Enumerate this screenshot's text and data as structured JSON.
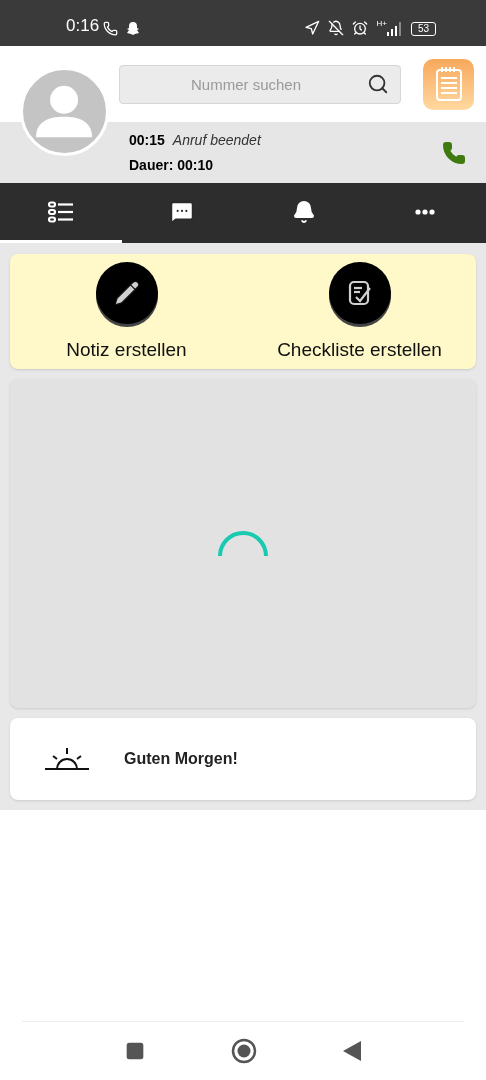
{
  "status_bar": {
    "time": "0:16",
    "network": "H+",
    "battery": "53"
  },
  "search": {
    "placeholder": "Nummer suchen"
  },
  "call": {
    "time": "00:15",
    "status": "Anruf beendet",
    "duration": "Dauer: 00:10"
  },
  "tabs": [
    {
      "kind": "list",
      "selected": true
    },
    {
      "kind": "chat",
      "selected": false
    },
    {
      "kind": "bell",
      "selected": false
    },
    {
      "kind": "more",
      "selected": false
    }
  ],
  "actions": [
    {
      "kind": "note",
      "label": "Notiz erstellen"
    },
    {
      "kind": "checklist",
      "label": "Checkliste erstellen"
    }
  ],
  "loading": true,
  "greeting": {
    "text": "Guten Morgen!"
  }
}
